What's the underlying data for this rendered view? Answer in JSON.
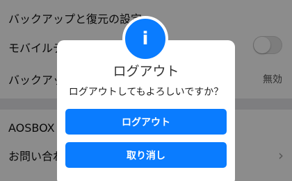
{
  "settings": {
    "backup_restore_section": "バックアップと復元の設定",
    "mobile_data_label": "モバイルデ",
    "backup_label": "バックアッ",
    "backup_value": "無効",
    "aosbox_label": "AOSBOX",
    "contact_label": "お問い合わ"
  },
  "dialog": {
    "icon": "info-icon",
    "icon_glyph": "i",
    "title": "ログアウト",
    "message": "ログアウトしてもよろしいですか？",
    "confirm_label": "ログアウト",
    "cancel_label": "取り消し"
  },
  "colors": {
    "accent": "#0a7cff",
    "overlay": "rgba(0,0,0,0.45)"
  }
}
